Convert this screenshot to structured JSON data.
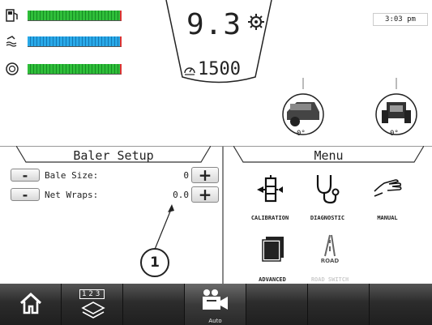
{
  "status": {
    "time": "3:03 pm",
    "ground_speed": "9.3",
    "engine_rpm": "1500",
    "baler_angle": "0°",
    "tractor_angle": "0°",
    "gauges": [
      {
        "name": "fuel-gauge",
        "color": "#2fbe3a",
        "level": 1.0
      },
      {
        "name": "def-gauge",
        "color": "#29a9e8",
        "level": 1.0
      },
      {
        "name": "bale-count-gauge",
        "color": "#2fbe3a",
        "level": 1.0
      }
    ]
  },
  "baler_setup": {
    "title": "Baler Setup",
    "rows": [
      {
        "label": "Bale Size:",
        "value": "0",
        "minus": "-",
        "plus": "+"
      },
      {
        "label": "Net Wraps:",
        "value": "0.0",
        "minus": "-",
        "plus": "+"
      }
    ]
  },
  "callout": {
    "number": "1"
  },
  "menu": {
    "title": "Menu",
    "items": [
      {
        "label": "CALIBRATION",
        "icon": "calibration-icon"
      },
      {
        "label": "DIAGNOSTIC",
        "icon": "stethoscope-icon"
      },
      {
        "label": "MANUAL",
        "icon": "hand-icon"
      },
      {
        "label": "ADVANCED",
        "icon": "advanced-icon"
      },
      {
        "label": "ROAD SWITCH",
        "icon": "road-icon",
        "icon_text": "ROAD"
      }
    ]
  },
  "nav": {
    "camera_caption": "Auto",
    "keypad_digits": "123"
  },
  "colors": {
    "accent_red": "#d33333",
    "nav_dark": "#2b2b2b"
  }
}
